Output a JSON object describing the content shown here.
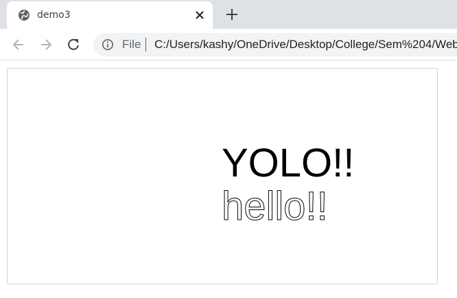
{
  "browser": {
    "tab": {
      "title": "demo3",
      "favicon": "globe-icon",
      "close_icon": "close-icon"
    },
    "new_tab_icon": "plus-icon",
    "nav": {
      "back": "back-arrow-icon",
      "forward": "forward-arrow-icon",
      "reload": "reload-icon"
    },
    "address": {
      "info_icon": "info-icon",
      "scheme": "File",
      "url": "C:/Users/kashy/OneDrive/Desktop/College/Sem%204/Web"
    }
  },
  "page": {
    "canvas_text_filled": "YOLO!!",
    "canvas_text_outlined": "hello!!",
    "colors": {
      "filled_text": "#000000",
      "outlined_text_stroke": "#000000",
      "canvas_border": "#d3d3d3",
      "tabstrip": "#dee1e6",
      "omnibox": "#f1f3f4"
    }
  }
}
